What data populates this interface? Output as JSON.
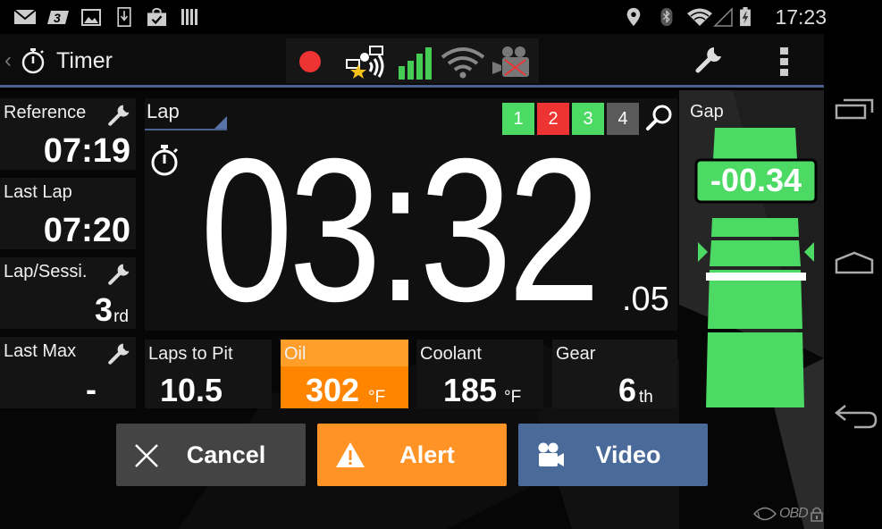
{
  "status_bar": {
    "left_icons": [
      "mail-icon",
      "three-network-icon",
      "image-icon",
      "download-icon",
      "store-bag-icon",
      "barcode-icon"
    ],
    "right_icons": [
      "location-icon",
      "bluetooth-icon",
      "wifi-icon",
      "signal-icon",
      "battery-charging-icon"
    ],
    "time": "17:23"
  },
  "action_bar": {
    "title": "Timer",
    "status_indicators": [
      "record-dot-icon",
      "satellite-gps-icon",
      "signal-bars-icon",
      "wifi-icon",
      "video-camera-disabled-icon"
    ],
    "record_color": "#ee3333",
    "signal_color": "#44cc55"
  },
  "left_panels": [
    {
      "label": "Reference",
      "value": "07:19",
      "has_settings": true
    },
    {
      "label": "Last Lap",
      "value": "07:20",
      "has_settings": false
    },
    {
      "label": "Lap/Sessi.",
      "value": "3",
      "suffix": "rd",
      "has_settings": true
    },
    {
      "label": "Last Max",
      "value": "-",
      "has_settings": true
    }
  ],
  "timer": {
    "mode_label": "Lap",
    "main_time": "03:32",
    "fraction": ".05",
    "lap_sectors": [
      {
        "label": "1",
        "color": "#4cd964"
      },
      {
        "label": "2",
        "color": "#ee3333"
      },
      {
        "label": "3",
        "color": "#4cd964"
      },
      {
        "label": "4",
        "color": "#5a5a5a"
      }
    ]
  },
  "bottom_panels": [
    {
      "label": "Laps to Pit",
      "value": "10.5",
      "suffix": ""
    },
    {
      "label": "Oil",
      "value": "302",
      "suffix": "°F",
      "alert": true
    },
    {
      "label": "Coolant",
      "value": "185",
      "suffix": "°F"
    },
    {
      "label": "Gear",
      "value": "6",
      "suffix": "th"
    }
  ],
  "gap": {
    "label": "Gap",
    "value": "-00.34",
    "color": "#4cd964"
  },
  "buttons": {
    "cancel": "Cancel",
    "alert": "Alert",
    "video": "Video"
  },
  "colors": {
    "alert_orange": "#ff9326",
    "oil_header": "#ff9f2a",
    "oil_body": "#ff8500",
    "video_blue": "#4a6a9a",
    "cancel_gray": "#444444",
    "accent_line": "#4a6190"
  },
  "footer": {
    "obd_text": "OBD"
  }
}
